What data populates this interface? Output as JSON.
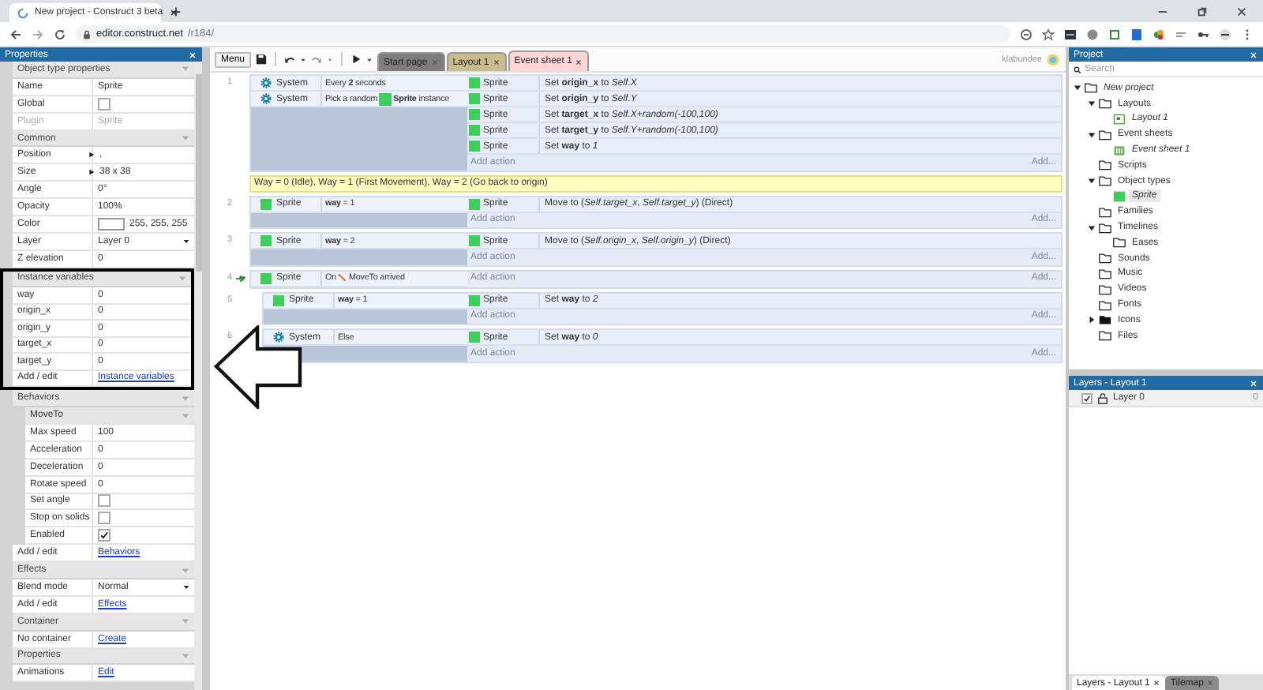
{
  "browser": {
    "tab_title": "New project - Construct 3 beta",
    "url_host": "editor.construct.net",
    "url_path": "/r184/"
  },
  "toolbar": {
    "menu": "Menu",
    "user": "klabundee",
    "tabs": [
      {
        "label": "Start page",
        "selected": false,
        "color": "#7d7d7d"
      },
      {
        "label": "Layout 1",
        "selected": false,
        "color": "#c9bb8e"
      },
      {
        "label": "Event sheet 1",
        "selected": true,
        "color": "#ffd4d4"
      }
    ]
  },
  "properties": {
    "title": "Properties",
    "sections": [
      {
        "title": "Object type properties",
        "highlighted": false,
        "rows": [
          {
            "kind": "text",
            "label": "Name",
            "value": "Sprite"
          },
          {
            "kind": "checkbox",
            "label": "Global",
            "checked": false
          },
          {
            "kind": "disabled",
            "label": "Plugin",
            "value": "Sprite"
          }
        ]
      },
      {
        "title": "Common",
        "highlighted": false,
        "rows": [
          {
            "kind": "expander",
            "label": "Position",
            "value": ","
          },
          {
            "kind": "expander",
            "label": "Size",
            "value": "38 x 38"
          },
          {
            "kind": "text",
            "label": "Angle",
            "value": "0°"
          },
          {
            "kind": "text",
            "label": "Opacity",
            "value": "100%"
          },
          {
            "kind": "color",
            "label": "Color",
            "value": "255, 255, 255"
          },
          {
            "kind": "dropdown",
            "label": "Layer",
            "value": "Layer 0"
          },
          {
            "kind": "text",
            "label": "Z elevation",
            "value": "0"
          }
        ]
      },
      {
        "title": "Instance variables",
        "highlighted": true,
        "rows": [
          {
            "kind": "text",
            "label": "way",
            "value": "0"
          },
          {
            "kind": "text",
            "label": "origin_x",
            "value": "0"
          },
          {
            "kind": "text",
            "label": "origin_y",
            "value": "0"
          },
          {
            "kind": "text",
            "label": "target_x",
            "value": "0"
          },
          {
            "kind": "text",
            "label": "target_y",
            "value": "0"
          },
          {
            "kind": "link",
            "label": "Add / edit",
            "value": "Instance variables"
          }
        ]
      },
      {
        "title": "Behaviors",
        "highlighted": false,
        "rows": [
          {
            "kind": "group",
            "label": "MoveTo",
            "rows": [
              {
                "kind": "text",
                "label": "Max speed",
                "value": "100"
              },
              {
                "kind": "text",
                "label": "Acceleration",
                "value": "0"
              },
              {
                "kind": "text",
                "label": "Deceleration",
                "value": "0"
              },
              {
                "kind": "text",
                "label": "Rotate speed",
                "value": "0"
              },
              {
                "kind": "checkbox",
                "label": "Set angle",
                "checked": false
              },
              {
                "kind": "checkbox",
                "label": "Stop on solids",
                "checked": false
              },
              {
                "kind": "checkbox",
                "label": "Enabled",
                "checked": true
              }
            ]
          },
          {
            "kind": "link",
            "label": "Add / edit",
            "value": "Behaviors"
          }
        ]
      },
      {
        "title": "Effects",
        "highlighted": false,
        "rows": [
          {
            "kind": "dropdown",
            "label": "Blend mode",
            "value": "Normal"
          },
          {
            "kind": "link",
            "label": "Add / edit",
            "value": "Effects"
          }
        ]
      },
      {
        "title": "Container",
        "highlighted": false,
        "rows": [
          {
            "kind": "link",
            "label": "No container",
            "value": "Create"
          }
        ]
      },
      {
        "title": "Properties",
        "highlighted": false,
        "rows": [
          {
            "kind": "link",
            "label": "Animations",
            "value": "Edit"
          }
        ]
      }
    ]
  },
  "events": [
    {
      "kind": "event",
      "number": "1",
      "add_action": "Add action",
      "add_more": "Add...",
      "conditions": [
        {
          "kind": "system",
          "object": "System",
          "segments": [
            {
              "kind": "text",
              "text": "Every **2** seconds"
            }
          ]
        },
        {
          "kind": "system",
          "object": "System",
          "segments": [
            {
              "kind": "text",
              "text": "Pick a random"
            },
            {
              "kind": "sprite"
            },
            {
              "kind": "text",
              "text": "**Sprite** instance"
            }
          ]
        }
      ],
      "actions": [
        {
          "kind": "sprite",
          "object": "Sprite",
          "text": "Set **origin_x** to *Self.X*"
        },
        {
          "kind": "sprite",
          "object": "Sprite",
          "text": "Set **origin_y** to *Self.Y*"
        },
        {
          "kind": "sprite",
          "object": "Sprite",
          "text": "Set **target_x** to *Self.X+random(-100,100)*"
        },
        {
          "kind": "sprite",
          "object": "Sprite",
          "text": "Set **target_y** to *Self.Y+random(-100,100)*"
        },
        {
          "kind": "sprite",
          "object": "Sprite",
          "text": "Set **way** to *1*"
        }
      ]
    },
    {
      "kind": "comment",
      "text": "Way = 0 (Idle), Way = 1 (First Movement), Way = 2 (Go back to origin)"
    },
    {
      "kind": "event",
      "number": "2",
      "add_action": "Add action",
      "add_more": "Add...",
      "conditions": [
        {
          "kind": "sprite",
          "object": "Sprite",
          "segments": [
            {
              "kind": "text",
              "text": "**way** = 1"
            }
          ]
        }
      ],
      "actions": [
        {
          "kind": "sprite",
          "object": "Sprite",
          "text": "Move to (*Self.target_x*, *Self.target_y*) (Direct)"
        }
      ]
    },
    {
      "kind": "event",
      "number": "3",
      "add_action": "Add action",
      "add_more": "Add...",
      "conditions": [
        {
          "kind": "sprite",
          "object": "Sprite",
          "segments": [
            {
              "kind": "text",
              "text": "**way** = 2"
            }
          ]
        }
      ],
      "actions": [
        {
          "kind": "sprite",
          "object": "Sprite",
          "text": "Move to (*Self.origin_x*, *Self.origin_y*) (Direct)"
        }
      ]
    },
    {
      "kind": "event",
      "number": "4",
      "trigger": true,
      "expanded": true,
      "add_action": "Add action",
      "add_more": "Add...",
      "conditions": [
        {
          "kind": "sprite",
          "object": "Sprite",
          "segments": [
            {
              "kind": "text",
              "text": "On"
            },
            {
              "kind": "behavior"
            },
            {
              "kind": "text",
              "text": "MoveTo arrived"
            }
          ]
        }
      ],
      "children": [
        {
          "kind": "event",
          "number": "5",
          "add_action": "Add action",
          "add_more": "Add...",
          "conditions": [
            {
              "kind": "sprite",
              "object": "Sprite",
              "segments": [
                {
                  "kind": "text",
                  "text": "**way** = 1"
                }
              ]
            }
          ],
          "actions": [
            {
              "kind": "sprite",
              "object": "Sprite",
              "text": "Set **way** to *2*"
            }
          ]
        },
        {
          "kind": "event",
          "number": "6",
          "add_action": "Add action",
          "add_more": "Add...",
          "conditions": [
            {
              "kind": "system",
              "object": "System",
              "segments": [
                {
                  "kind": "text",
                  "text": "Else"
                }
              ]
            }
          ],
          "actions": [
            {
              "kind": "sprite",
              "object": "Sprite",
              "text": "Set **way** to *0*"
            }
          ]
        }
      ]
    }
  ],
  "project": {
    "title": "Project",
    "search_placeholder": "Search",
    "tree": [
      {
        "label": "New project",
        "kind": "folder",
        "italic": true,
        "selected": false,
        "expanded": true,
        "children": [
          {
            "label": "Layouts",
            "kind": "folder",
            "selected": false,
            "expanded": true,
            "children": [
              {
                "label": "Layout 1",
                "kind": "layout",
                "italic": true,
                "selected": false
              }
            ]
          },
          {
            "label": "Event sheets",
            "kind": "folder",
            "selected": false,
            "expanded": true,
            "children": [
              {
                "label": "Event sheet 1",
                "kind": "eventsheet",
                "italic": true,
                "selected": false
              }
            ]
          },
          {
            "label": "Scripts",
            "kind": "folder",
            "selected": false
          },
          {
            "label": "Object types",
            "kind": "folder",
            "selected": false,
            "expanded": true,
            "children": [
              {
                "label": "Sprite",
                "kind": "sprite",
                "italic": true,
                "selected": true
              }
            ]
          },
          {
            "label": "Families",
            "kind": "folder",
            "selected": false
          },
          {
            "label": "Timelines",
            "kind": "folder",
            "selected": false,
            "expanded": true,
            "children": [
              {
                "label": "Eases",
                "kind": "folder",
                "selected": false
              }
            ]
          },
          {
            "label": "Sounds",
            "kind": "folder",
            "selected": false
          },
          {
            "label": "Music",
            "kind": "folder",
            "selected": false
          },
          {
            "label": "Videos",
            "kind": "folder",
            "selected": false
          },
          {
            "label": "Fonts",
            "kind": "folder",
            "selected": false
          },
          {
            "label": "Icons",
            "kind": "folder-filled",
            "selected": false,
            "expanded": false
          },
          {
            "label": "Files",
            "kind": "folder",
            "selected": false
          }
        ]
      }
    ]
  },
  "layers": {
    "title": "Layers - Layout 1",
    "rows": [
      {
        "name": "Layer 0",
        "visible": true,
        "count": "0"
      }
    ]
  },
  "bottom_tabs": [
    {
      "label": "Layers - Layout 1",
      "selected": true
    },
    {
      "label": "Tilemap",
      "selected": false
    }
  ]
}
